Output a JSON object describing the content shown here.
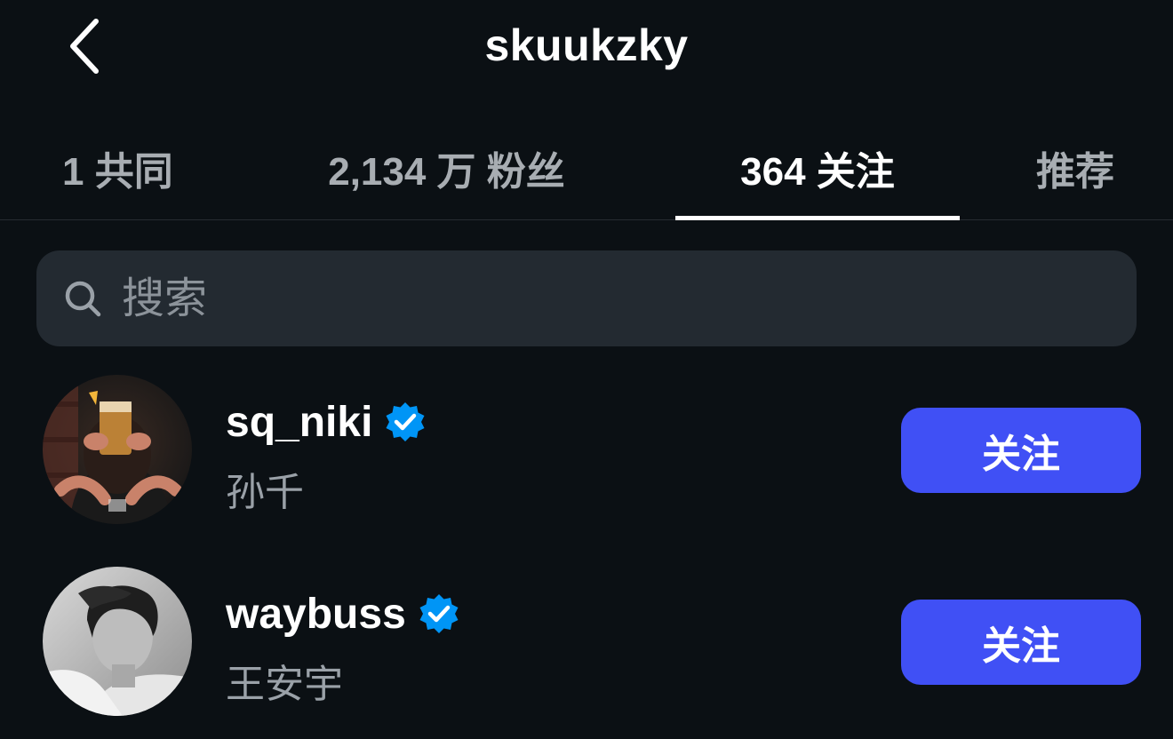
{
  "header": {
    "title": "skuukzky",
    "back_icon": "chevron-left-icon"
  },
  "tabs": [
    {
      "label": "1 共同",
      "active": false
    },
    {
      "label": "2,134 万 粉丝",
      "active": false
    },
    {
      "label": "364 关注",
      "active": true
    },
    {
      "label": "推荐",
      "active": false
    }
  ],
  "search": {
    "placeholder": "搜索",
    "value": "",
    "icon": "search-icon"
  },
  "users": [
    {
      "username": "sq_niki",
      "full_name": "孙千",
      "verified": true,
      "follow_label": "关注"
    },
    {
      "username": "waybuss",
      "full_name": "王安宇",
      "verified": true,
      "follow_label": "关注"
    }
  ],
  "colors": {
    "background": "#0b1014",
    "accent": "#4050f5",
    "verified_badge": "#0095f6",
    "search_bg": "#232a31",
    "secondary_text": "#9aa1a8"
  }
}
